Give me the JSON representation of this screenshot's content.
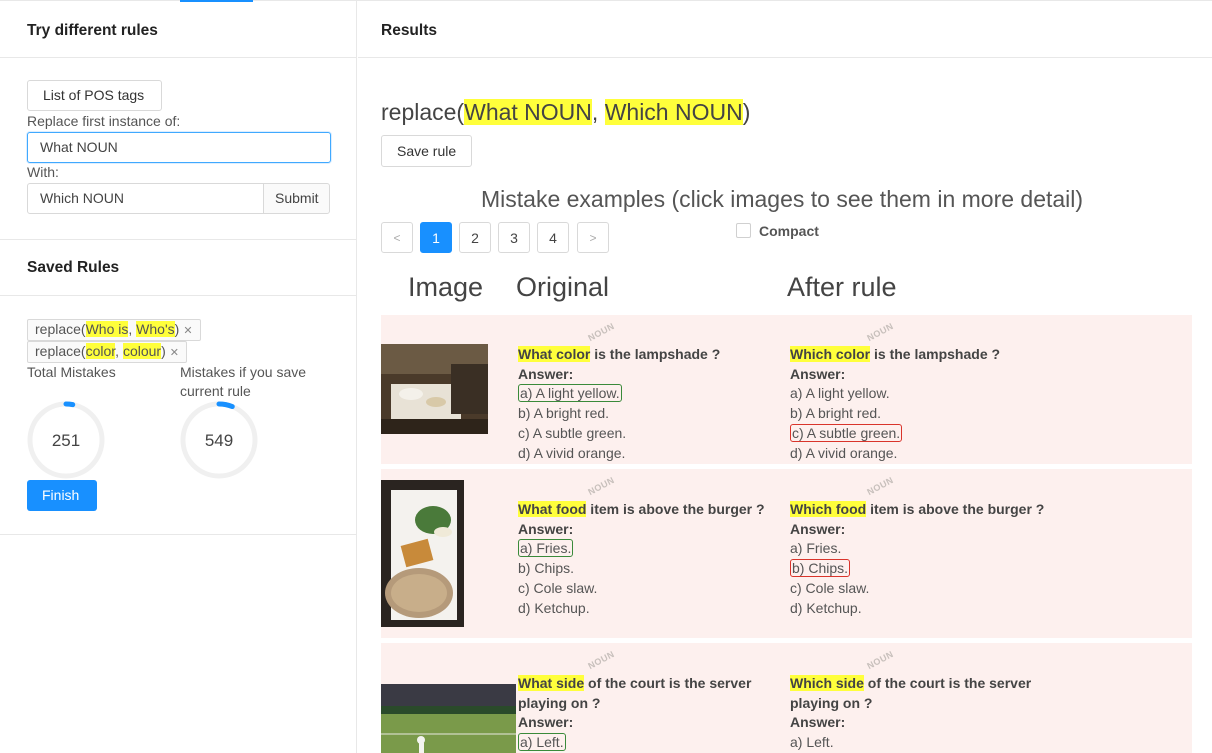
{
  "left": {
    "title": "Try different rules",
    "pos_button": "List of POS tags",
    "replace_label": "Replace first instance of:",
    "replace_value": "What NOUN",
    "with_label": "With:",
    "with_value": "Which NOUN",
    "submit": "Submit",
    "saved_title": "Saved Rules",
    "saved_rules": [
      {
        "prefix": "replace(",
        "a": "Who is",
        "sep": ", ",
        "b": "Who's",
        "suffix": ")"
      },
      {
        "prefix": "replace(",
        "a": "color",
        "sep": ", ",
        "b": "colour",
        "suffix": ")"
      }
    ],
    "total_mistakes_label": "Total Mistakes",
    "total_mistakes": "251",
    "total_progress": 0.03,
    "save_mistakes_label_1": "Mistakes if you save",
    "save_mistakes_label_2": "current rule",
    "save_mistakes": "549",
    "save_progress": 0.06,
    "finish": "Finish"
  },
  "right": {
    "title": "Results",
    "rule": {
      "prefix": "replace(",
      "a": "What NOUN",
      "sep": ", ",
      "b": "Which NOUN",
      "suffix": ")"
    },
    "save_rule": "Save rule",
    "mistake_title": "Mistake examples (click images to see them in more detail)",
    "pages": [
      "1",
      "2",
      "3",
      "4"
    ],
    "active_page": "1",
    "prev": "<",
    "next": ">",
    "compact": "Compact",
    "columns": [
      "Image",
      "Original",
      "After rule"
    ],
    "noun_tag": "NOUN"
  },
  "colors": {
    "accent": "#1890ff",
    "highlight": "#ffff3b",
    "row_bg": "#fdf0ee",
    "correct": "#3a8a3a",
    "wrong": "#d9342b"
  },
  "examples": [
    {
      "orig_q1": "What color",
      "orig_q2": " is the lampshade ?",
      "new_q1": "Which color",
      "new_q2": " is the lampshade ?",
      "answer_label": "Answer:",
      "options": [
        "a) A light yellow.",
        "b) A bright red.",
        "c) A subtle green.",
        "d) A vivid orange."
      ]
    },
    {
      "orig_q1": "What food",
      "orig_q2": " item is above the burger ?",
      "new_q1": "Which food",
      "new_q2": " item is above the burger ?",
      "answer_label": "Answer:",
      "options": [
        "a) Fries.",
        "b) Chips.",
        "c) Cole slaw.",
        "d) Ketchup."
      ]
    },
    {
      "orig_q1": "What side",
      "orig_q2": " of the court is the server playing on ?",
      "new_q1": "Which side",
      "new_q2": " of the court is the server playing on ?",
      "answer_label": "Answer:",
      "options": [
        "a) Left."
      ]
    }
  ]
}
